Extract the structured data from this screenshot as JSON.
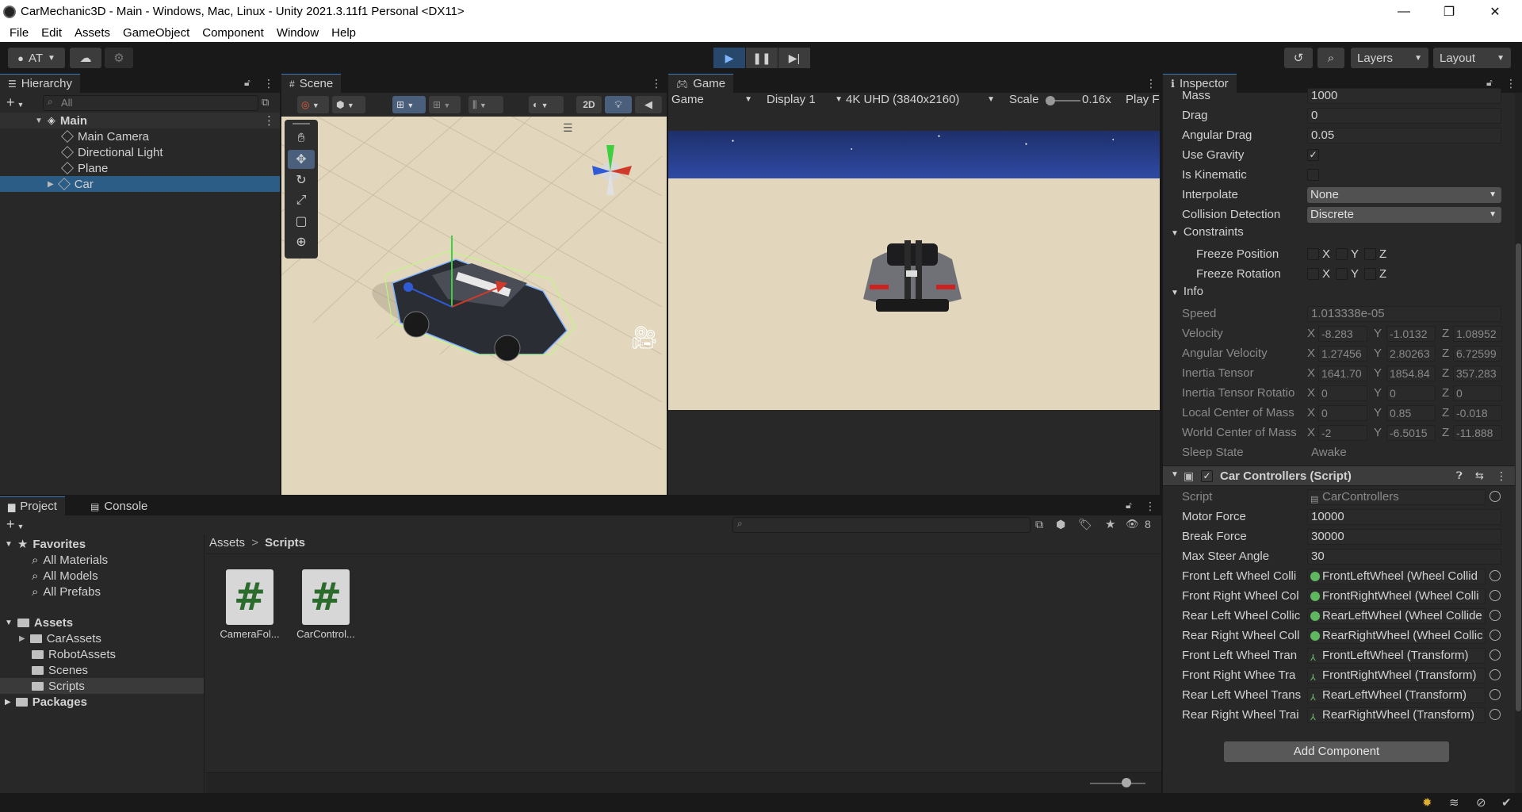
{
  "window": {
    "title": "CarMechanic3D - Main - Windows, Mac, Linux - Unity 2021.3.11f1 Personal <DX11>",
    "minimize": "—",
    "restore": "❐",
    "close": "✕"
  },
  "menu": [
    "File",
    "Edit",
    "Assets",
    "GameObject",
    "Component",
    "Window",
    "Help"
  ],
  "toolbar": {
    "account": "AT",
    "layers": "Layers",
    "layout": "Layout"
  },
  "hierarchy": {
    "tab": "Hierarchy",
    "search_placeholder": "All",
    "root": "Main",
    "items": [
      "Main Camera",
      "Directional Light",
      "Plane",
      "Car"
    ]
  },
  "scene": {
    "tab": "Scene",
    "mode_2d": "2D"
  },
  "game": {
    "tab": "Game",
    "view": "Game",
    "display": "Display 1",
    "resolution": "4K UHD (3840x2160)",
    "scale_label": "Scale",
    "scale_value": "0.16x",
    "play_mode": "Play F"
  },
  "inspector": {
    "tab": "Inspector",
    "rigidbody": {
      "mass": {
        "label": "Mass",
        "value": "1000"
      },
      "drag": {
        "label": "Drag",
        "value": "0"
      },
      "angular_drag": {
        "label": "Angular Drag",
        "value": "0.05"
      },
      "use_gravity": {
        "label": "Use Gravity",
        "checked": "✓"
      },
      "is_kinematic": {
        "label": "Is Kinematic"
      },
      "interpolate": {
        "label": "Interpolate",
        "value": "None"
      },
      "collision": {
        "label": "Collision Detection",
        "value": "Discrete"
      },
      "constraints": "Constraints",
      "freeze_position": "Freeze Position",
      "freeze_rotation": "Freeze Rotation",
      "axes": [
        "X",
        "Y",
        "Z"
      ],
      "info": "Info",
      "speed": {
        "label": "Speed",
        "value": "1.013338e-05"
      },
      "velocity": {
        "label": "Velocity",
        "x": "-8.283",
        "y": "-1.0132",
        "z": "1.08952"
      },
      "angular_velocity": {
        "label": "Angular Velocity",
        "x": "1.27456",
        "y": "2.80263",
        "z": "6.72599"
      },
      "inertia_tensor": {
        "label": "Inertia Tensor",
        "x": "1641.70",
        "y": "1854.84",
        "z": "357.283"
      },
      "inertia_tensor_rotation": {
        "label": "Inertia Tensor Rotatio",
        "x": "0",
        "y": "0",
        "z": "0"
      },
      "local_com": {
        "label": "Local Center of Mass",
        "x": "0",
        "y": "0.85",
        "z": "-0.018"
      },
      "world_com": {
        "label": "World Center of Mass",
        "x": "-2",
        "y": "-6.5015",
        "z": "-11.888"
      },
      "sleep_state": {
        "label": "Sleep State",
        "value": "Awake"
      }
    },
    "car_controllers": {
      "title": "Car Controllers (Script)",
      "script": {
        "label": "Script",
        "value": "CarControllers"
      },
      "motor_force": {
        "label": "Motor Force",
        "value": "10000"
      },
      "break_force": {
        "label": "Break Force",
        "value": "30000"
      },
      "max_steer_angle": {
        "label": "Max Steer Angle",
        "value": "30"
      },
      "refs": [
        {
          "label": "Front Left Wheel Colli",
          "value": "FrontLeftWheel (Wheel Collid"
        },
        {
          "label": "Front Right Wheel Col",
          "value": "FrontRightWheel (Wheel Colli"
        },
        {
          "label": "Rear Left Wheel Collic",
          "value": "RearLeftWheel (Wheel Collide"
        },
        {
          "label": "Rear Right Wheel Coll",
          "value": "RearRightWheel (Wheel Collic"
        },
        {
          "label": "Front Left Wheel Tran",
          "value": "FrontLeftWheel (Transform)"
        },
        {
          "label": "Front Right Whee Tra",
          "value": "FrontRightWheel (Transform)"
        },
        {
          "label": "Rear Left Wheel Trans",
          "value": "RearLeftWheel (Transform)"
        },
        {
          "label": "Rear Right Wheel Trai",
          "value": "RearRightWheel (Transform)"
        }
      ]
    },
    "add_component": "Add Component"
  },
  "project": {
    "tab_project": "Project",
    "tab_console": "Console",
    "favorites": "Favorites",
    "fav_items": [
      "All Materials",
      "All Models",
      "All Prefabs"
    ],
    "assets": "Assets",
    "asset_folders": [
      "CarAssets",
      "RobotAssets",
      "Scenes",
      "Scripts"
    ],
    "packages": "Packages",
    "breadcrumb_root": "Assets",
    "breadcrumb_sep": ">",
    "breadcrumb_current": "Scripts",
    "hidden_count": "8",
    "files": [
      "CameraFol...",
      "CarControl..."
    ]
  },
  "colors": {
    "accent": "#3a79bb",
    "selection": "#2c5d87",
    "play_active": "#27486b"
  }
}
